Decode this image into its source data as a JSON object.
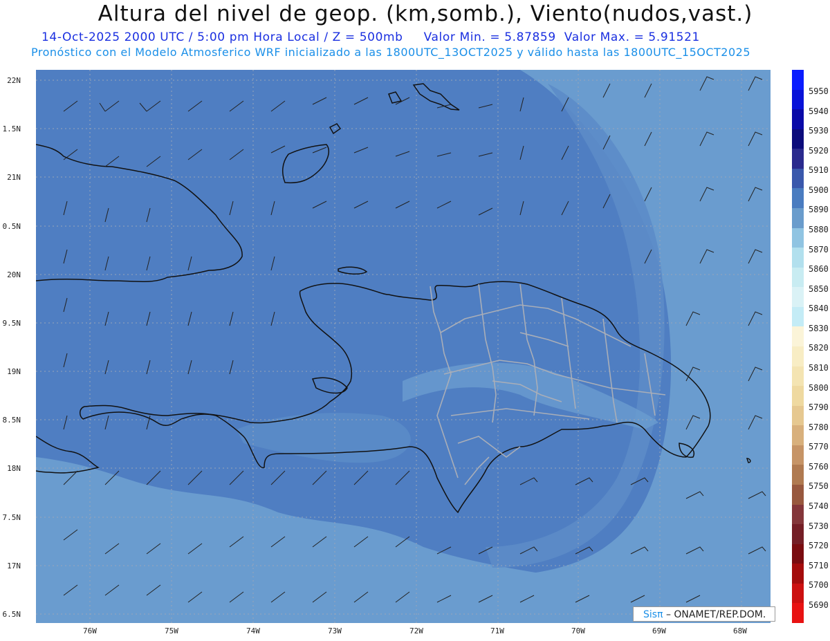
{
  "header": {
    "title": "Altura del nivel de geop. (km,somb.), Viento(nudos,vast.)",
    "date_time": "14-Oct-2025  2000 UTC / 5:00 pm Hora Local / Z = 500mb",
    "valor_min": "Valor Min. = 5.87859",
    "valor_max": "Valor Max. = 5.91521",
    "forecast_note": "Pronóstico con el Modelo Atmosferico WRF inicializado a las 1800UTC_13OCT2025 y válido hasta las  1800UTC_15OCT2025"
  },
  "map": {
    "y_axis_labels": [
      "22N",
      "1.5N",
      "21N",
      "0.5N",
      "20N",
      "9.5N",
      "19N",
      "8.5N",
      "18N",
      "7.5N",
      "17N",
      "6.5N"
    ],
    "x_axis_labels": [
      "76W",
      "75W",
      "74W",
      "73W",
      "72W",
      "71W",
      "70W",
      "69W",
      "68W"
    ],
    "fill_colors": {
      "low": "#4f7ec2",
      "mid": "#5b8dc8",
      "high": "#6a9fd0",
      "ocean_band": "#6b9ccc"
    },
    "coast_color": "#111111",
    "province_color": "#a9aeb8"
  },
  "colorbar": {
    "labels": [
      "5950",
      "5940",
      "5930",
      "5920",
      "5910",
      "5900",
      "5890",
      "5880",
      "5870",
      "5860",
      "5850",
      "5840",
      "5830",
      "5820",
      "5810",
      "5800",
      "5790",
      "5780",
      "5770",
      "5760",
      "5750",
      "5740",
      "5730",
      "5720",
      "5710",
      "5700",
      "5690"
    ],
    "colors": [
      "#0a1cff",
      "#0812d8",
      "#0a0aa8",
      "#0c0c7c",
      "#2a2a8e",
      "#3a58ac",
      "#4a7cc0",
      "#6a9ccc",
      "#90c4e2",
      "#b2e0ee",
      "#c8ecf2",
      "#daf2f6",
      "#c4ecf6",
      "#fbf4d8",
      "#f8edc4",
      "#f4e4b2",
      "#efd9a0",
      "#e6c890",
      "#d8b07c",
      "#c69466",
      "#b07a50",
      "#98583e",
      "#84363a",
      "#741e26",
      "#7a0c10",
      "#a40c0c",
      "#cc1010",
      "#e81212"
    ]
  },
  "credit": {
    "brand": "Sisπ",
    "text": " – ONAMET/REP.DOM."
  }
}
